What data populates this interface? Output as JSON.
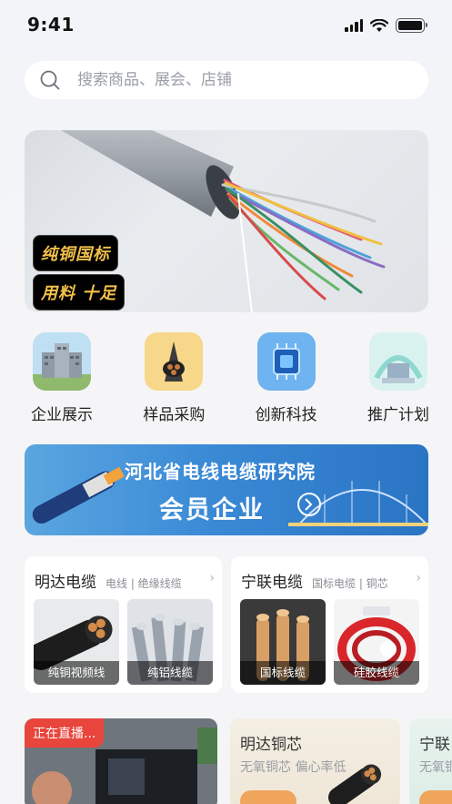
{
  "status": {
    "time": "9:41",
    "icons": [
      "signal-icon",
      "wifi-icon",
      "battery-icon"
    ]
  },
  "search": {
    "placeholder": "搜索商品、展会、店铺",
    "icon": "search-icon"
  },
  "hero": {
    "tag1": "纯铜国标",
    "tag2": "用料 十足"
  },
  "categories": [
    {
      "label": "企业展示",
      "icon": "building-icon"
    },
    {
      "label": "样品采购",
      "icon": "cable-sample-icon"
    },
    {
      "label": "创新科技",
      "icon": "ai-chip-icon"
    },
    {
      "label": "推广计划",
      "icon": "promotion-icon"
    }
  ],
  "member_banner": {
    "title": "河北省电线电缆研究院",
    "subtitle": "会员企业"
  },
  "shops": [
    {
      "name": "明达电缆",
      "tags": "电线 | 绝缘线缆",
      "products": [
        "纯铜视频线",
        "纯铝线缆"
      ]
    },
    {
      "name": "宁联电缆",
      "tags": "国标电缆 | 铜芯",
      "products": [
        "国标线缆",
        "硅胶线缆"
      ]
    }
  ],
  "live": {
    "badge": "正在直播..."
  },
  "promos": [
    {
      "title": "明达铜芯",
      "subtitle": "无氧铜芯 偏心率低"
    },
    {
      "title": "宁联",
      "subtitle": "无氧铜"
    }
  ],
  "colors": {
    "accent_live": "#e8453c",
    "member_blue": "#3b8ad6",
    "gold_tag": "#f2c14a"
  }
}
